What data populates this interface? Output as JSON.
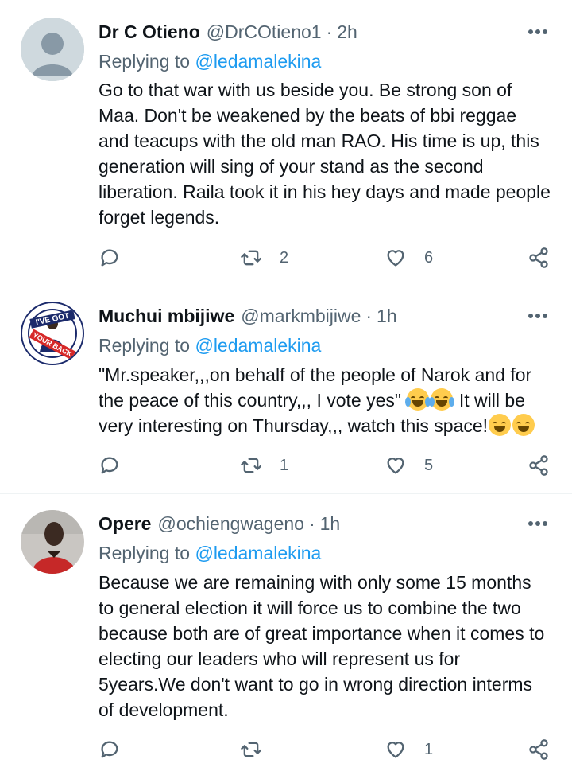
{
  "tweets": [
    {
      "display_name": "Dr C Otieno",
      "handle": "@DrCOtieno1",
      "separator": "·",
      "time": "2h",
      "replying_prefix": "Replying to",
      "replying_to": "@ledamalekina",
      "text_parts": [
        "Go to that war with us beside you. Be strong son of Maa. Don't be weakened by the beats of bbi reggae and teacups with the old man RAO. His time is up, this generation will sing of your stand as the second liberation. Raila took it in his hey days and made people forget legends."
      ],
      "retweets": "2",
      "likes": "6",
      "avatar": "default-avatar"
    },
    {
      "display_name": "Muchui mbijiwe",
      "handle": "@markmbijiwe",
      "separator": "·",
      "time": "1h",
      "replying_prefix": "Replying to",
      "replying_to": "@ledamalekina",
      "text_parts": [
        "\"Mr.speaker,,,on behalf of the people of Narok and for the peace of this country,,, I vote yes\" ",
        "  It will be very interesting on Thursday,,, watch this space!"
      ],
      "emojis": [
        "face-with-tears-of-joy-emoji",
        "grinning-face-emoji"
      ],
      "retweets": "1",
      "likes": "5",
      "avatar": "ive-got-your-back-avatar",
      "avatar_text": [
        "I'VE GOT",
        "YOUR BACK"
      ]
    },
    {
      "display_name": "Opere",
      "handle": "@ochiengwageno",
      "separator": "·",
      "time": "1h",
      "replying_prefix": "Replying to",
      "replying_to": "@ledamalekina",
      "text_parts": [
        "Because we are remaining with only some 15 months to general election it will force us to combine the two because both are of great importance when it comes to electing our leaders who will represent us for 5years.We don't want to go in wrong direction interms of development."
      ],
      "retweets": "",
      "likes": "1",
      "avatar": "photo-avatar"
    }
  ],
  "icons": {
    "more": "more-horizontal-icon",
    "reply": "reply-icon",
    "retweet": "retweet-icon",
    "like": "heart-icon",
    "share": "share-icon"
  },
  "colors": {
    "link": "#1d9bf0",
    "secondary": "#536471",
    "divider": "#eff3f4"
  }
}
